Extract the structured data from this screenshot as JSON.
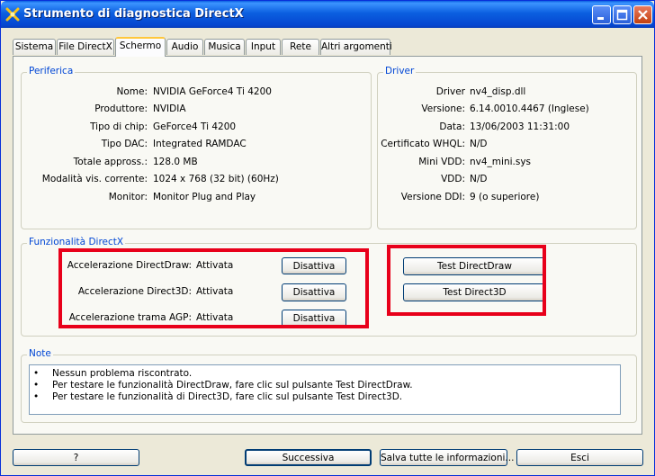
{
  "window": {
    "title": "Strumento di diagnostica DirectX"
  },
  "tabs": [
    {
      "label": "Sistema"
    },
    {
      "label": "File DirectX"
    },
    {
      "label": "Schermo",
      "active": true
    },
    {
      "label": "Audio"
    },
    {
      "label": "Musica"
    },
    {
      "label": "Input"
    },
    {
      "label": "Rete"
    },
    {
      "label": "Altri argomenti"
    }
  ],
  "device": {
    "group_label": "Periferica",
    "rows": [
      {
        "label": "Nome:",
        "value": "NVIDIA GeForce4 Ti 4200"
      },
      {
        "label": "Produttore:",
        "value": "NVIDIA"
      },
      {
        "label": "Tipo di chip:",
        "value": "GeForce4 Ti 4200"
      },
      {
        "label": "Tipo DAC:",
        "value": "Integrated RAMDAC"
      },
      {
        "label": "Totale appross.:",
        "value": "128.0 MB"
      },
      {
        "label": "Modalità vis. corrente:",
        "value": "1024 x 768 (32 bit) (60Hz)"
      },
      {
        "label": "Monitor:",
        "value": "Monitor Plug and Play"
      }
    ]
  },
  "driver": {
    "group_label": "Driver",
    "rows": [
      {
        "label": "Driver",
        "value": "nv4_disp.dll"
      },
      {
        "label": "Versione:",
        "value": "6.14.0010.4467 (Inglese)"
      },
      {
        "label": "Data:",
        "value": "13/06/2003 11:31:00"
      },
      {
        "label": "Certificato WHQL:",
        "value": "N/D"
      },
      {
        "label": "Mini VDD:",
        "value": "nv4_mini.sys"
      },
      {
        "label": "VDD:",
        "value": "N/D"
      },
      {
        "label": "Versione DDI:",
        "value": "9 (o superiore)"
      }
    ]
  },
  "features": {
    "group_label": "Funzionalità DirectX",
    "rows": [
      {
        "label": "Accelerazione DirectDraw:",
        "status": "Attivata",
        "button": "Disattiva"
      },
      {
        "label": "Accelerazione Direct3D:",
        "status": "Attivata",
        "button": "Disattiva"
      },
      {
        "label": "Accelerazione trama AGP:",
        "status": "Attivata",
        "button": "Disattiva"
      }
    ],
    "test_buttons": [
      "Test DirectDraw",
      "Test Direct3D"
    ]
  },
  "notes": {
    "group_label": "Note",
    "bullet": "•",
    "items": [
      "Nessun problema riscontrato.",
      "Per testare le funzionalità DirectDraw, fare clic sul pulsante Test DirectDraw.",
      "Per testare le funzionalità di Direct3D, fare clic sul pulsante Test Direct3D."
    ]
  },
  "bottom_buttons": {
    "help": "?",
    "next": "Successiva",
    "save_all": "Salva tutte le informazioni...",
    "exit": "Esci"
  },
  "colors": {
    "titlebar": "#0a5fe0",
    "group_label": "#0046d5",
    "highlight_box": "#e8001a"
  }
}
